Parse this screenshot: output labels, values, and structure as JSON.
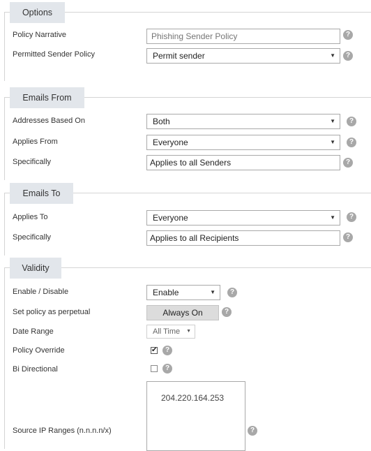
{
  "options": {
    "header": "Options",
    "policy_narrative": {
      "label": "Policy Narrative",
      "placeholder": "Phishing Sender Policy"
    },
    "permitted_sender_policy": {
      "label": "Permitted Sender Policy",
      "value": "Permit sender"
    }
  },
  "emails_from": {
    "header": "Emails From",
    "addresses_based_on": {
      "label": "Addresses Based On",
      "value": "Both"
    },
    "applies_from": {
      "label": "Applies From",
      "value": "Everyone"
    },
    "specifically": {
      "label": "Specifically",
      "value": "Applies to all Senders"
    }
  },
  "emails_to": {
    "header": "Emails To",
    "applies_to": {
      "label": "Applies To",
      "value": "Everyone"
    },
    "specifically": {
      "label": "Specifically",
      "value": "Applies to all Recipients"
    }
  },
  "validity": {
    "header": "Validity",
    "enable_disable": {
      "label": "Enable / Disable",
      "value": "Enable"
    },
    "perpetual": {
      "label": "Set policy as perpetual",
      "button": "Always On"
    },
    "date_range": {
      "label": "Date Range",
      "value": "All Time"
    },
    "policy_override": {
      "label": "Policy Override",
      "checked": true
    },
    "bi_directional": {
      "label": "Bi Directional",
      "checked": false
    },
    "source_ip": {
      "label": "Source IP Ranges (n.n.n.n/x)",
      "value": "204.220.164.253"
    }
  },
  "help_glyph": "?",
  "icons": {
    "help": "help-circle-icon",
    "dropdown": "dropdown-arrow-icon",
    "check": "checkmark-icon"
  },
  "colors": {
    "header_bg": "#e2e6eb",
    "border": "#d4d4d4",
    "help_icon": "#a8a8a8",
    "button_bg": "#dcdcdc"
  }
}
